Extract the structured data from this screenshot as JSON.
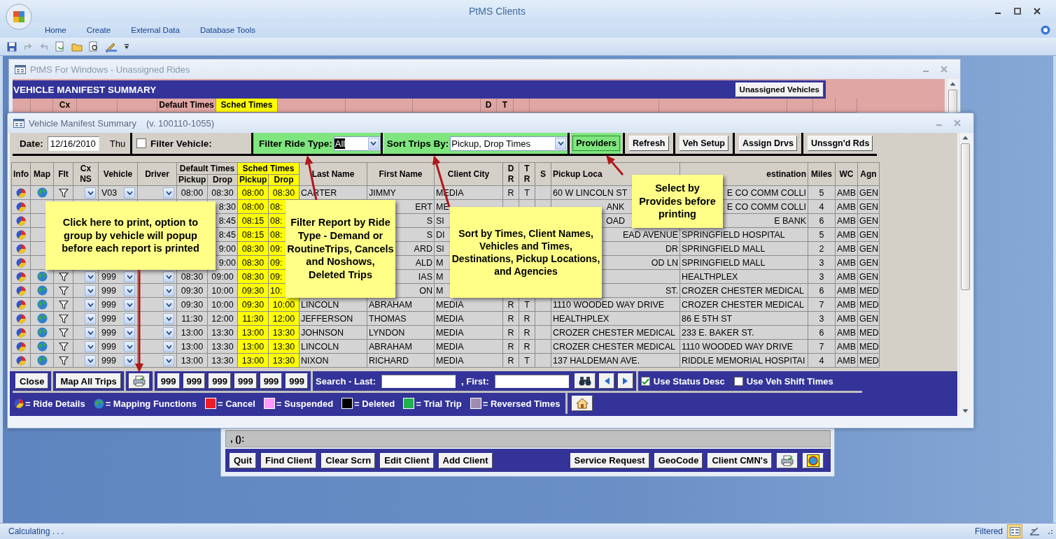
{
  "app": {
    "title": "PtMS Clients",
    "ribbon_tabs": [
      "Home",
      "Create",
      "External Data",
      "Database Tools"
    ]
  },
  "unassigned_window": {
    "title": "PtMS For Windows - Unassigned Rides",
    "heading": "VEHICLE MANIFEST SUMMARY",
    "button": "Unassigned Vehicles",
    "header_cells": [
      {
        "label": "Cx",
        "highlight": false
      },
      {
        "label": "Default Times",
        "highlight": false
      },
      {
        "label": "Sched Times",
        "highlight": true
      },
      {
        "label": "D",
        "highlight": false
      },
      {
        "label": "T",
        "highlight": false
      }
    ]
  },
  "client_window": {
    "status": ", ():",
    "left_buttons": [
      {
        "kind": "text",
        "label": "Quit"
      },
      {
        "kind": "text",
        "label": "Find Client"
      },
      {
        "kind": "text",
        "label": "Clear Scrn"
      },
      {
        "kind": "text",
        "label": "Edit Client"
      },
      {
        "kind": "text",
        "label": "Add Client"
      }
    ],
    "right_buttons": [
      {
        "kind": "text",
        "label": "Service Request"
      },
      {
        "kind": "text",
        "label": "GeoCode"
      },
      {
        "kind": "text",
        "label": "Client CMN's"
      },
      {
        "kind": "print"
      },
      {
        "kind": "globe"
      }
    ]
  },
  "manifest_window": {
    "title": "Vehicle Manifest Summary",
    "version": "(v. 100110-1055)",
    "toolbar": {
      "date": {
        "label": "Date:",
        "value": "12/16/2010",
        "weekday": "Thu"
      },
      "filter_vehicle": {
        "label": "Filter Vehicle:",
        "checked": false
      },
      "ride_type": {
        "label": "Filter Ride Type:",
        "value": "All",
        "text_selected": true,
        "highlighted": true
      },
      "sort": {
        "label": "Sort Trips By:",
        "value": "Pickup, Drop Times",
        "highlighted": true
      },
      "buttons": [
        {
          "label": "Providers",
          "highlighted": true
        },
        {
          "label": "Refresh",
          "highlighted": false
        },
        {
          "label": "Veh Setup",
          "highlighted": false
        },
        {
          "label": "Assign Drvs",
          "highlighted": false
        },
        {
          "label": "Unssgn'd Rds",
          "highlighted": false
        }
      ]
    },
    "table": {
      "groups": [
        {
          "label": "Default Times",
          "highlight": false
        },
        {
          "label": "Sched Times",
          "highlight": true
        }
      ],
      "columns": [
        {
          "label": "Info",
          "highlight": false
        },
        {
          "label": "Map",
          "highlight": false
        },
        {
          "label": "Flt",
          "highlight": false
        },
        {
          "label": "Cx\nNS",
          "highlight": false
        },
        {
          "label": "Vehicle",
          "highlight": false
        },
        {
          "label": "Driver",
          "highlight": false
        },
        {
          "label": "Pickup",
          "highlight": false
        },
        {
          "label": "Drop",
          "highlight": false
        },
        {
          "label": "Pickup",
          "highlight": true
        },
        {
          "label": "Drop",
          "highlight": true
        },
        {
          "label": "Last Name",
          "highlight": false
        },
        {
          "label": "First Name",
          "highlight": false
        },
        {
          "label": "Client City",
          "highlight": false
        },
        {
          "label": "D\nR",
          "highlight": false
        },
        {
          "label": "T\nR",
          "highlight": false
        },
        {
          "label": "S",
          "highlight": false
        },
        {
          "label": "Pickup Loca",
          "highlight": false,
          "cut_end": true
        },
        {
          "label": "estination",
          "highlight": false,
          "cut_start": true
        },
        {
          "label": "Miles",
          "highlight": false
        },
        {
          "label": "WC",
          "highlight": false
        },
        {
          "label": "Agn",
          "highlight": false
        }
      ],
      "rows": [
        [
          {
            "kind": "ride-icon"
          },
          {
            "kind": "globe-icon"
          },
          {
            "kind": "filter-icon"
          },
          {
            "kind": "dropdown"
          },
          {
            "kind": "dropdown",
            "text": "V03"
          },
          {
            "kind": "dropdown"
          },
          "08:00",
          "08:30",
          "08:00",
          "08:30",
          "CARTER",
          "JIMMY",
          "MEDIA",
          "R",
          "T",
          {
            "kind": "blank"
          },
          "60 W LINCOLN ST",
          {
            "kind": "text",
            "text": "E CO COMM COLLI",
            "cut_start": true
          },
          "5",
          "AMB",
          "GEN"
        ],
        [
          {
            "kind": "ride-icon"
          },
          {
            "kind": "blank"
          },
          {
            "kind": "blank"
          },
          {
            "kind": "blank"
          },
          {
            "kind": "blank"
          },
          {
            "kind": "blank"
          },
          {
            "kind": "blank"
          },
          {
            "kind": "text",
            "text": "8:30",
            "cut_start": true
          },
          "08:00",
          {
            "kind": "text",
            "text": "08:",
            "cut_end": true
          },
          {
            "kind": "blank"
          },
          {
            "kind": "text",
            "text": "ERT",
            "cut_start": true
          },
          {
            "kind": "text",
            "text": "ME",
            "cut_end": true
          },
          {
            "kind": "blank"
          },
          {
            "kind": "blank"
          },
          {
            "kind": "blank"
          },
          {
            "kind": "text",
            "text": "ANK",
            "cut_start": true,
            "cut_end": true
          },
          {
            "kind": "text",
            "text": "E CO COMM COLLI",
            "cut_start": true
          },
          "4",
          "AMB",
          "GEN"
        ],
        [
          {
            "kind": "ride-icon"
          },
          {
            "kind": "blank"
          },
          {
            "kind": "blank"
          },
          {
            "kind": "blank"
          },
          {
            "kind": "blank"
          },
          {
            "kind": "blank"
          },
          {
            "kind": "blank"
          },
          {
            "kind": "text",
            "text": "8:45",
            "cut_start": true
          },
          "08:15",
          {
            "kind": "text",
            "text": "08:",
            "cut_end": true
          },
          {
            "kind": "blank"
          },
          {
            "kind": "text",
            "text": "S",
            "cut_start": true
          },
          {
            "kind": "text",
            "text": "SI",
            "cut_end": true
          },
          {
            "kind": "blank"
          },
          {
            "kind": "blank"
          },
          {
            "kind": "blank"
          },
          {
            "kind": "text",
            "text": "OAD",
            "cut_start": true,
            "cut_end": true
          },
          {
            "kind": "text",
            "text": "E BANK",
            "cut_start": true
          },
          "6",
          "AMB",
          "GEN"
        ],
        [
          {
            "kind": "ride-icon"
          },
          {
            "kind": "blank"
          },
          {
            "kind": "blank"
          },
          {
            "kind": "blank"
          },
          {
            "kind": "blank"
          },
          {
            "kind": "blank"
          },
          {
            "kind": "blank"
          },
          {
            "kind": "text",
            "text": "8:45",
            "cut_start": true
          },
          "08:15",
          {
            "kind": "text",
            "text": "08:",
            "cut_end": true
          },
          {
            "kind": "blank"
          },
          {
            "kind": "text",
            "text": "S",
            "cut_start": true
          },
          {
            "kind": "text",
            "text": "DI",
            "cut_end": true
          },
          {
            "kind": "blank"
          },
          {
            "kind": "blank"
          },
          {
            "kind": "blank"
          },
          {
            "kind": "text",
            "text": "EAD AVENUE",
            "cut_start": true
          },
          "SPRINGFIELD HOSPITAL",
          "5",
          "AMB",
          "GEN"
        ],
        [
          {
            "kind": "ride-icon"
          },
          {
            "kind": "blank"
          },
          {
            "kind": "blank"
          },
          {
            "kind": "blank"
          },
          {
            "kind": "blank"
          },
          {
            "kind": "blank"
          },
          {
            "kind": "blank"
          },
          {
            "kind": "text",
            "text": "9:00",
            "cut_start": true
          },
          "08:30",
          {
            "kind": "text",
            "text": "09:",
            "cut_end": true
          },
          {
            "kind": "blank"
          },
          {
            "kind": "text",
            "text": "ARD",
            "cut_start": true
          },
          {
            "kind": "text",
            "text": "SI",
            "cut_end": true
          },
          {
            "kind": "blank"
          },
          {
            "kind": "blank"
          },
          {
            "kind": "blank"
          },
          {
            "kind": "text",
            "text": "DR",
            "cut_start": true
          },
          "SPRINGFIELD MALL",
          "2",
          "AMB",
          "GEN"
        ],
        [
          {
            "kind": "ride-icon"
          },
          {
            "kind": "blank"
          },
          {
            "kind": "blank"
          },
          {
            "kind": "blank"
          },
          {
            "kind": "blank"
          },
          {
            "kind": "blank"
          },
          {
            "kind": "blank"
          },
          {
            "kind": "text",
            "text": "9:00",
            "cut_start": true
          },
          "08:30",
          {
            "kind": "text",
            "text": "09:",
            "cut_end": true
          },
          {
            "kind": "blank"
          },
          {
            "kind": "text",
            "text": "ALD",
            "cut_start": true
          },
          {
            "kind": "text",
            "text": "M",
            "cut_end": true
          },
          {
            "kind": "blank"
          },
          {
            "kind": "blank"
          },
          {
            "kind": "blank"
          },
          {
            "kind": "text",
            "text": "OD LN",
            "cut_start": true
          },
          "SPRINGFIELD MALL",
          "3",
          "AMB",
          "GEN"
        ],
        [
          {
            "kind": "ride-icon"
          },
          {
            "kind": "globe-icon"
          },
          {
            "kind": "filter-icon"
          },
          {
            "kind": "dropdown"
          },
          {
            "kind": "dropdown",
            "text": "999"
          },
          {
            "kind": "dropdown"
          },
          "08:30",
          "09:00",
          "08:30",
          {
            "kind": "text",
            "text": "09:",
            "cut_end": true
          },
          {
            "kind": "blank"
          },
          {
            "kind": "text",
            "text": "IAS",
            "cut_start": true
          },
          {
            "kind": "text",
            "text": "M",
            "cut_end": true
          },
          {
            "kind": "blank"
          },
          {
            "kind": "blank"
          },
          {
            "kind": "blank"
          },
          {
            "kind": "blank"
          },
          "HEALTHPLEX",
          "3",
          "AMB",
          "GEN"
        ],
        [
          {
            "kind": "ride-icon"
          },
          {
            "kind": "globe-icon"
          },
          {
            "kind": "filter-icon"
          },
          {
            "kind": "dropdown"
          },
          {
            "kind": "dropdown",
            "text": "999"
          },
          {
            "kind": "dropdown"
          },
          "09:30",
          "10:00",
          "09:30",
          {
            "kind": "text",
            "text": "10:",
            "cut_end": true
          },
          {
            "kind": "blank"
          },
          {
            "kind": "text",
            "text": "ON",
            "cut_start": true
          },
          {
            "kind": "text",
            "text": "M",
            "cut_end": true
          },
          {
            "kind": "blank"
          },
          {
            "kind": "blank"
          },
          {
            "kind": "blank"
          },
          {
            "kind": "text",
            "text": "ST.",
            "cut_start": true
          },
          "CROZER CHESTER MEDICAL",
          "6",
          "AMB",
          "MED"
        ],
        [
          {
            "kind": "ride-icon"
          },
          {
            "kind": "globe-icon"
          },
          {
            "kind": "filter-icon"
          },
          {
            "kind": "dropdown"
          },
          {
            "kind": "dropdown",
            "text": "999"
          },
          {
            "kind": "dropdown"
          },
          "09:30",
          "10:00",
          "09:30",
          "10:00",
          "LINCOLN",
          "ABRAHAM",
          "MEDIA",
          "R",
          "T",
          {
            "kind": "blank"
          },
          "1110 WOODED WAY DRIVE",
          "CROZER CHESTER MEDICAL",
          "7",
          "AMB",
          "MED"
        ],
        [
          {
            "kind": "ride-icon"
          },
          {
            "kind": "globe-icon"
          },
          {
            "kind": "filter-icon"
          },
          {
            "kind": "dropdown"
          },
          {
            "kind": "dropdown",
            "text": "999"
          },
          {
            "kind": "dropdown"
          },
          "11:30",
          "12:00",
          "11:30",
          "12:00",
          "JEFFERSON",
          "THOMAS",
          "MEDIA",
          "R",
          "R",
          {
            "kind": "blank"
          },
          "HEALTHPLEX",
          "86 E 5TH ST",
          "3",
          "AMB",
          "GEN"
        ],
        [
          {
            "kind": "ride-icon"
          },
          {
            "kind": "globe-icon"
          },
          {
            "kind": "filter-icon"
          },
          {
            "kind": "dropdown"
          },
          {
            "kind": "dropdown",
            "text": "999"
          },
          {
            "kind": "dropdown"
          },
          "13:00",
          "13:30",
          "13:00",
          "13:30",
          "JOHNSON",
          "LYNDON",
          "MEDIA",
          "R",
          "R",
          {
            "kind": "blank"
          },
          "CROZER CHESTER MEDICAL",
          "233 E. BAKER ST.",
          "6",
          "AMB",
          "MED"
        ],
        [
          {
            "kind": "ride-icon"
          },
          {
            "kind": "globe-icon"
          },
          {
            "kind": "filter-icon"
          },
          {
            "kind": "dropdown"
          },
          {
            "kind": "dropdown",
            "text": "999"
          },
          {
            "kind": "dropdown"
          },
          "13:00",
          "13:30",
          "13:00",
          "13:30",
          "LINCOLN",
          "ABRAHAM",
          "MEDIA",
          "R",
          "R",
          {
            "kind": "blank"
          },
          "CROZER CHESTER MEDICAL",
          "1110 WOODED WAY DRIVE",
          "7",
          "AMB",
          "MED"
        ],
        [
          {
            "kind": "ride-icon"
          },
          {
            "kind": "globe-icon"
          },
          {
            "kind": "filter-icon"
          },
          {
            "kind": "dropdown"
          },
          {
            "kind": "dropdown",
            "text": "999"
          },
          {
            "kind": "dropdown"
          },
          "13:00",
          "13:30",
          "13:00",
          "13:30",
          "NIXON",
          "RICHARD",
          "MEDIA",
          "R",
          "T",
          {
            "kind": "blank"
          },
          "137 HALDEMAN AVE.",
          "RIDDLE MEMORIAL HOSPITAI",
          "4",
          "AMB",
          "MED"
        ]
      ]
    },
    "bottom_bar": {
      "buttons": [
        {
          "kind": "text",
          "label": "Close"
        },
        {
          "kind": "text",
          "label": "Map All Trips"
        },
        {
          "kind": "print"
        }
      ],
      "vehicle_buttons": [
        "999",
        "999",
        "999",
        "999",
        "999",
        "999"
      ],
      "search": {
        "last_label": "Search - Last:",
        "first_label": ", First:"
      },
      "options": [
        {
          "label": "Use Status Desc",
          "checked": true
        },
        {
          "label": "Use Veh Shift Times",
          "checked": false
        }
      ]
    },
    "legend": [
      {
        "kind": "ride-icon",
        "label": "= Ride Details"
      },
      {
        "kind": "globe-icon",
        "label": "= Mapping Functions"
      },
      {
        "kind": "swatch",
        "color": "#ee1c24",
        "label": "= Cancel"
      },
      {
        "kind": "swatch",
        "color": "#ff99ff",
        "label": "= Suspended"
      },
      {
        "kind": "swatch",
        "color": "#000000",
        "label": "= Deleted"
      },
      {
        "kind": "swatch",
        "color": "#22b14c",
        "label": "= Trial Trip"
      },
      {
        "kind": "swatch",
        "color": "#a08cb0",
        "label": "= Reversed Times"
      }
    ]
  },
  "notes": [
    {
      "text": "Click here to print, option to group by vehicle will popup before each report is printed"
    },
    {
      "text": "Filter Report by Ride Type - Demand or RoutineTrips, Cancels and Noshows, Deleted Trips"
    },
    {
      "text": "Sort by Times, Client Names, Vehicles and Times, Destinations, Pickup Locations, and Agencies"
    },
    {
      "text": "Select by Provides before printing"
    }
  ],
  "status_bar": {
    "left": "Calculating . . .",
    "right": "Filtered"
  }
}
